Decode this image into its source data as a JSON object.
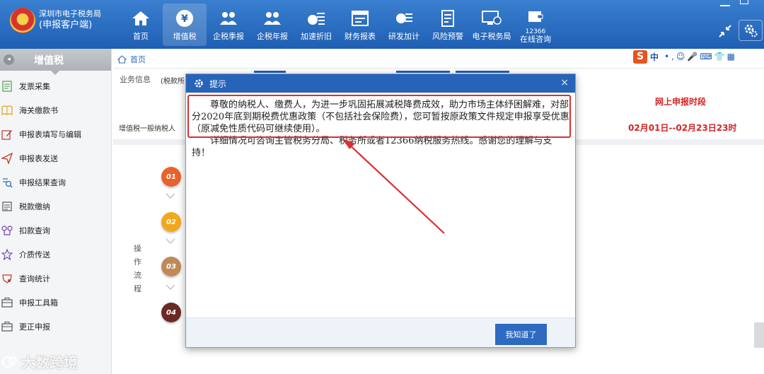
{
  "app": {
    "brand_line1": "深圳市电子税务局",
    "brand_line2": "(申报客户端)"
  },
  "nav": [
    {
      "label": "首页",
      "icon": "home-icon"
    },
    {
      "label": "增值税",
      "icon": "yen-icon",
      "active": true
    },
    {
      "label": "企税季报",
      "icon": "people-icon"
    },
    {
      "label": "企税年报",
      "icon": "people-icon"
    },
    {
      "label": "加速折旧",
      "icon": "coin-list-icon"
    },
    {
      "label": "财务报表",
      "icon": "report-icon"
    },
    {
      "label": "研发加计",
      "icon": "coin-stack-icon"
    },
    {
      "label": "风险预警",
      "icon": "document-icon"
    },
    {
      "label": "电子税务局",
      "icon": "monitor-icon"
    },
    {
      "label": "在线咨询",
      "sup": "12366",
      "icon": "wallet-icon"
    }
  ],
  "sidebar": {
    "title": "增值税",
    "items": [
      {
        "label": "发票采集",
        "icon": "invoice-icon"
      },
      {
        "label": "海关缴款书",
        "icon": "book-icon"
      },
      {
        "label": "申报表填写与编辑",
        "icon": "edit-icon"
      },
      {
        "label": "申报表发送",
        "icon": "send-icon"
      },
      {
        "label": "申报结果查询",
        "icon": "query-icon"
      },
      {
        "label": "税款缴纳",
        "icon": "payment-icon"
      },
      {
        "label": "扣款查询",
        "icon": "deduct-icon"
      },
      {
        "label": "介质传送",
        "icon": "star-icon"
      },
      {
        "label": "查询统计",
        "icon": "stats-icon"
      },
      {
        "label": "申报工具箱",
        "icon": "toolbox-icon"
      },
      {
        "label": "更正申报",
        "icon": "correction-icon"
      }
    ]
  },
  "content": {
    "breadcrumb": "首页",
    "biz_label": "业务信息",
    "biz_label2": "(税款所",
    "vat_row_label": "增值税一般纳税人",
    "online_title": "网上申报时段",
    "online_date": "02月01日--02月23日23时",
    "step_title": "操作流程",
    "steps": [
      "01",
      "02",
      "03",
      "04"
    ],
    "step_colors": [
      "#e9622b",
      "#f2a81d",
      "#c08a58",
      "#6b2a25"
    ]
  },
  "ime": {
    "logo": "S",
    "mode": "中",
    "rest": "•,☺🎤⌨👕▦"
  },
  "modal": {
    "title": "提示",
    "paragraph1": "尊敬的纳税人、缴费人，为进一步巩固拓展减税降费成效，助力市场主体纾困解难，对部分2020年底到期税费优惠政策（不包括社会保险费），您可暂按原政策文件规定申报享受优惠（原减免性质代码可继续使用）。",
    "paragraph2": "详细情况可咨询主管税务分局、税务所或者12366纳税服务热线。感谢您的理解与支持！",
    "ok_button": "我知道了"
  },
  "watermark": "大数跨境",
  "colors": {
    "header": "#1f5fb3",
    "accent_red": "#d42525",
    "button_blue": "#2d6ac0"
  }
}
